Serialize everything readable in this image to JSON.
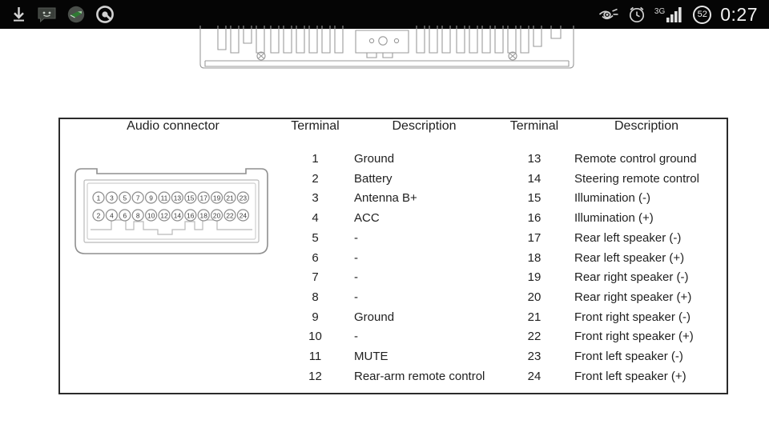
{
  "status_bar": {
    "left_icons": [
      {
        "name": "download-icon",
        "label": "download"
      },
      {
        "name": "sms-message-icon",
        "label": "message"
      },
      {
        "name": "green-app-icon",
        "label": "app"
      },
      {
        "name": "circle-app-icon",
        "label": "app"
      }
    ],
    "right_icons": [
      {
        "name": "eye-icon",
        "label": "eye"
      },
      {
        "name": "alarm-clock-icon",
        "label": "alarm"
      }
    ],
    "network_label": "3G",
    "battery_percent": "52",
    "clock": "0:27"
  },
  "document": {
    "head_unit": {
      "caption": "car stereo chassis rear view"
    },
    "table": {
      "headers": {
        "connector": "Audio connector",
        "terminal_left": "Terminal",
        "description_left": "Description",
        "terminal_right": "Terminal",
        "description_right": "Description"
      },
      "connector": {
        "top_row_pins": [
          "1",
          "3",
          "5",
          "7",
          "9",
          "11",
          "13",
          "15",
          "17",
          "19",
          "21",
          "23"
        ],
        "bottom_row_pins": [
          "2",
          "4",
          "6",
          "8",
          "10",
          "12",
          "14",
          "16",
          "18",
          "20",
          "22",
          "24"
        ]
      },
      "left_block": {
        "terminals": [
          "1",
          "2",
          "3",
          "4",
          "5",
          "6",
          "7",
          "8",
          "9",
          "10",
          "11",
          "12"
        ],
        "descriptions": [
          "Ground",
          "Battery",
          "Antenna B+",
          "ACC",
          "-",
          "-",
          "-",
          "-",
          "Ground",
          "-",
          "MUTE",
          "Rear-arm remote control"
        ]
      },
      "right_block": {
        "terminals": [
          "13",
          "14",
          "15",
          "16",
          "17",
          "18",
          "19",
          "20",
          "21",
          "22",
          "23",
          "24"
        ],
        "descriptions": [
          "Remote control ground",
          "Steering remote control",
          "Illumination (-)",
          "Illumination (+)",
          "Rear left speaker (-)",
          "Rear left speaker (+)",
          "Rear right speaker (-)",
          "Rear right speaker (+)",
          "Front right speaker (-)",
          "Front right speaker (+)",
          "Front left speaker (-)",
          "Front left speaker (+)"
        ]
      }
    }
  },
  "colors": {
    "status_bar_bg": "#050505",
    "page_bg": "#ffffff",
    "table_border": "#2b2b2b",
    "text": "#1f1f1f",
    "line_art": "#9a9a9a"
  }
}
